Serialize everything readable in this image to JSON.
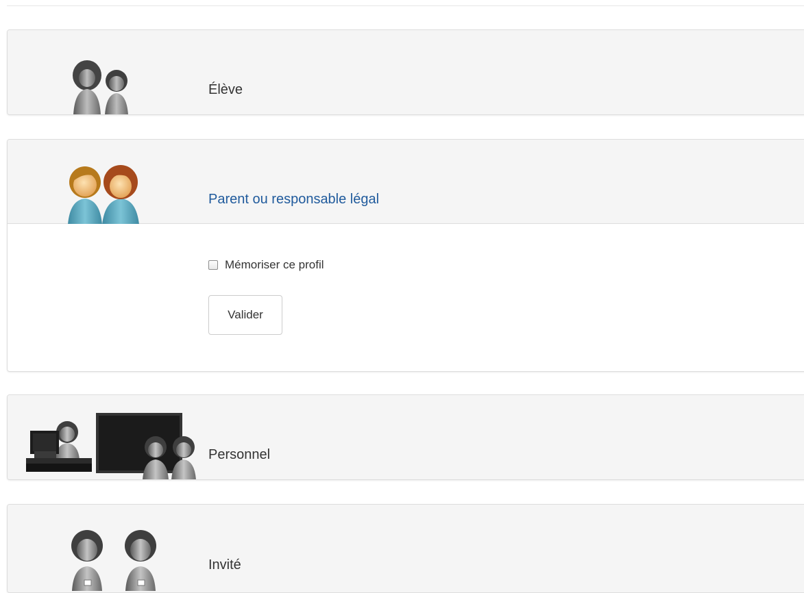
{
  "profiles": [
    {
      "label": "Élève",
      "icon": "students-icon"
    },
    {
      "label": "Parent ou responsable légal",
      "icon": "parents-icon"
    },
    {
      "label": "Personnel",
      "icon": "staff-icon"
    },
    {
      "label": "Invité",
      "icon": "guests-icon"
    }
  ],
  "form": {
    "remember_label": "Mémoriser ce profil",
    "remember_checked": false,
    "submit_label": "Valider"
  },
  "colors": {
    "active_label": "#1f5a9c",
    "panel_header_bg": "#f5f5f5",
    "parent_body": "#5aa6bd",
    "parent_skin": "#f3c98b",
    "hair_blond": "#b77a1c",
    "hair_red": "#a64a1c"
  }
}
